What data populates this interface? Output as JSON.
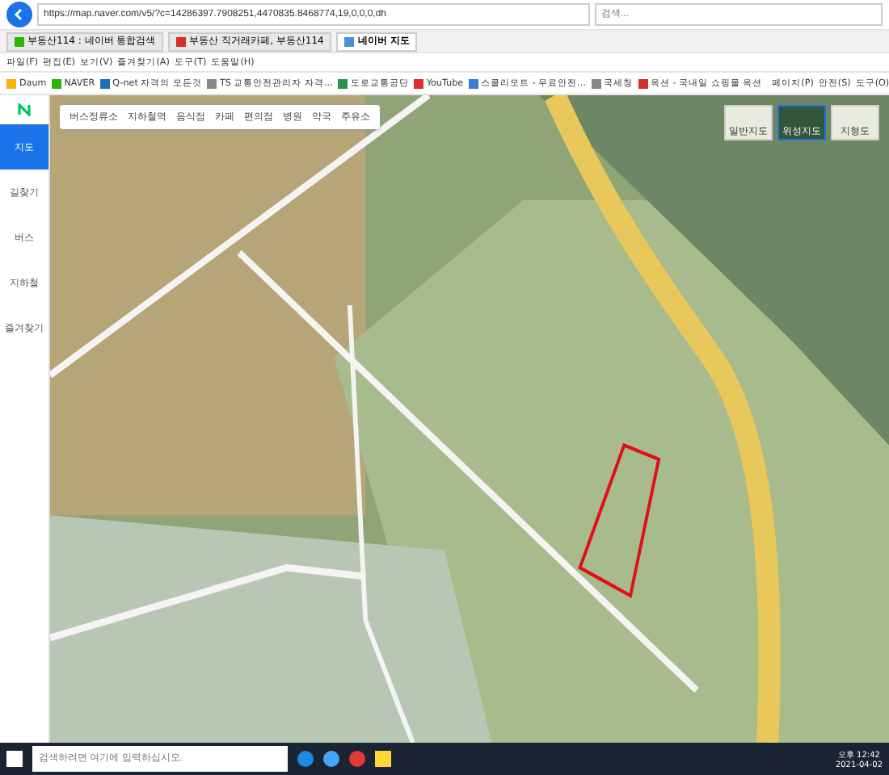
{
  "address_bar": {
    "url": "https://map.naver.com/v5/?c=14286397.7908251,4470835.8468774,19,0,0,0,dh",
    "search_placeholder": "검색..."
  },
  "tabs": [
    {
      "label": "부동산114 : 네이버 통합검색",
      "selected": false,
      "color": "#2db400"
    },
    {
      "label": "부동산 직거래카페, 부동산114",
      "selected": false,
      "color": "#d93025"
    },
    {
      "label": "네이버 지도",
      "selected": true,
      "color": "#4a90d9"
    }
  ],
  "menu": [
    "파일(F)",
    "편집(E)",
    "보기(V)",
    "즐겨찾기(A)",
    "도구(T)",
    "도움말(H)"
  ],
  "bookmarks": [
    {
      "label": "Daum",
      "color": "#f4b400"
    },
    {
      "label": "NAVER",
      "color": "#2db400"
    },
    {
      "label": "Q-net 자격의 모든것",
      "color": "#1a6fb5"
    },
    {
      "label": "TS 교통안전관리자 자격...",
      "color": "#888888"
    },
    {
      "label": "도로교통공단",
      "color": "#2d8f4e"
    },
    {
      "label": "YouTube",
      "color": "#e52d27"
    },
    {
      "label": "스쿨리모트 - 무료안전...",
      "color": "#3a7bd5"
    },
    {
      "label": "국세청",
      "color": "#888888"
    },
    {
      "label": "옥션 - 국내일 쇼핑몰 옥션",
      "color": "#d93025"
    }
  ],
  "command_bar": [
    "페이지(P)",
    "안전(S)",
    "도구(O)"
  ],
  "sidebar": [
    {
      "label": "지도",
      "selected": true
    },
    {
      "label": "길찾기",
      "selected": false
    },
    {
      "label": "버스",
      "selected": false
    },
    {
      "label": "지하철",
      "selected": false
    },
    {
      "label": "즐겨찾기",
      "selected": false
    }
  ],
  "map_filters": [
    "버스정류소",
    "지하철역",
    "음식점",
    "카페",
    "편의점",
    "병원",
    "약국",
    "주유소"
  ],
  "map_types": [
    {
      "label": "일반지도",
      "selected": false
    },
    {
      "label": "위성지도",
      "selected": true
    },
    {
      "label": "지형도",
      "selected": false
    }
  ],
  "taskbar": {
    "search_placeholder": "검색하려면 여기에 입력하십시오.",
    "time": "오후 12:42",
    "date": "2021-04-02"
  }
}
